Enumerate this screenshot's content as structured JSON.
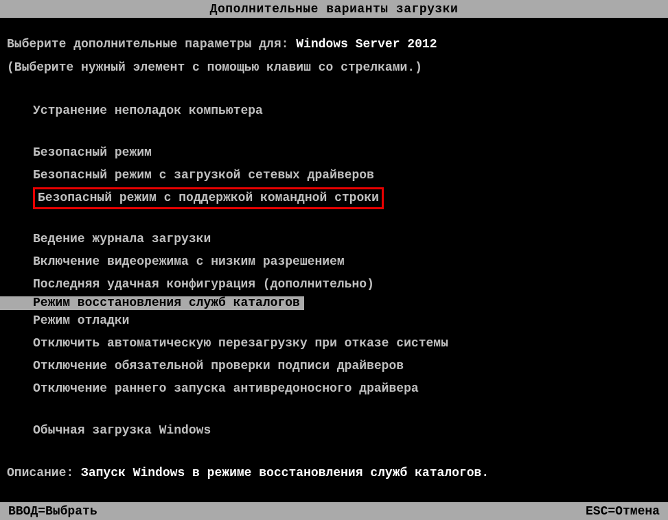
{
  "title": "Дополнительные варианты загрузки",
  "prompt": {
    "prefix": "Выберите дополнительные параметры для: ",
    "os": "Windows Server 2012",
    "hint": "(Выберите нужный элемент с помощью клавиш со стрелками.)"
  },
  "options": {
    "repair": "Устранение неполадок компьютера",
    "safe_mode": "Безопасный режим",
    "safe_mode_net": "Безопасный режим с загрузкой сетевых драйверов",
    "safe_mode_cmd": "Безопасный режим с поддержкой командной строки",
    "boot_logging": "Ведение журнала загрузки",
    "low_res": "Включение видеорежима с низким разрешением",
    "last_known": "Последняя удачная конфигурация (дополнительно)",
    "dsrm": "Режим восстановления служб каталогов",
    "debug": "Режим отладки",
    "disable_auto_restart": "Отключить автоматическую перезагрузку при отказе системы",
    "disable_driver_sig": "Отключение обязательной проверки подписи драйверов",
    "disable_elam": "Отключение раннего запуска антивредоносного драйвера",
    "normal": "Обычная загрузка Windows"
  },
  "description": {
    "label": "Описание: ",
    "text": "Запуск Windows в режиме восстановления служб каталогов."
  },
  "footer": {
    "enter": "ВВОД=Выбрать",
    "esc": "ESC=Отмена"
  }
}
